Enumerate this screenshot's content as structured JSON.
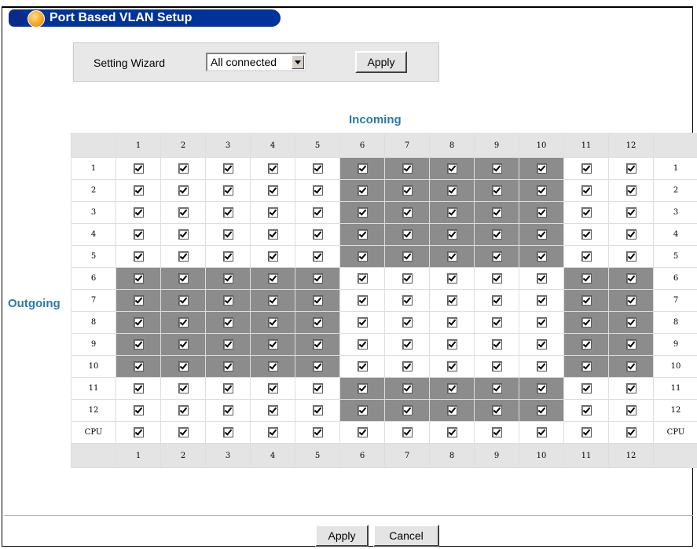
{
  "page_title_fragment": "",
  "panel": {
    "title": "Port Based VLAN Setup"
  },
  "wizard": {
    "label": "Setting Wizard",
    "select_value": "All connected",
    "apply_label": "Apply"
  },
  "matrix": {
    "incoming_label": "Incoming",
    "outgoing_label": "Outgoing",
    "columns": [
      "1",
      "2",
      "3",
      "4",
      "5",
      "6",
      "7",
      "8",
      "9",
      "10",
      "11",
      "12"
    ],
    "rows": [
      "1",
      "2",
      "3",
      "4",
      "5",
      "6",
      "7",
      "8",
      "9",
      "10",
      "11",
      "12",
      "CPU"
    ],
    "all_checked": true,
    "shaded_cells": {
      "1": [
        6,
        7,
        8,
        9,
        10
      ],
      "2": [
        6,
        7,
        8,
        9,
        10
      ],
      "3": [
        6,
        7,
        8,
        9,
        10
      ],
      "4": [
        6,
        7,
        8,
        9,
        10
      ],
      "5": [
        6,
        7,
        8,
        9,
        10
      ],
      "6": [
        1,
        2,
        3,
        4,
        5,
        11,
        12
      ],
      "7": [
        1,
        2,
        3,
        4,
        5,
        11,
        12
      ],
      "8": [
        1,
        2,
        3,
        4,
        5,
        11,
        12
      ],
      "9": [
        1,
        2,
        3,
        4,
        5,
        11,
        12
      ],
      "10": [
        1,
        2,
        3,
        4,
        5,
        11,
        12
      ],
      "11": [
        6,
        7,
        8,
        9,
        10
      ],
      "12": [
        6,
        7,
        8,
        9,
        10
      ],
      "CPU": []
    },
    "shaded_color": "#8c8c8c",
    "header_color": "#e4e4e4"
  },
  "footer": {
    "apply_label": "Apply",
    "cancel_label": "Cancel"
  },
  "colors": {
    "title_bar": "#003399",
    "label_accent": "#2a7aa8"
  }
}
